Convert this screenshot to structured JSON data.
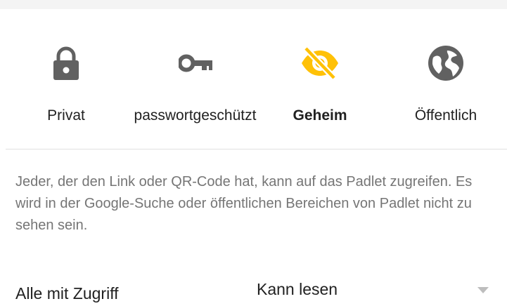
{
  "privacy": {
    "options": [
      {
        "id": "private",
        "label": "Privat",
        "icon": "lock-icon",
        "selected": false
      },
      {
        "id": "password",
        "label": "passwortgeschützt",
        "icon": "key-icon",
        "selected": false
      },
      {
        "id": "secret",
        "label": "Geheim",
        "icon": "eye-off-icon",
        "selected": true
      },
      {
        "id": "public",
        "label": "Öffentlich",
        "icon": "globe-icon",
        "selected": false
      }
    ]
  },
  "description": "Jeder, der den Link oder QR-Code hat, kann auf das Padlet zugreifen. Es wird in der Google-Suche oder öffentlichen Bereichen von Padlet nicht zu sehen sein.",
  "access": {
    "label": "Alle mit Zugriff",
    "selected_value": "Kann lesen"
  },
  "colors": {
    "icon_default": "#616161",
    "icon_selected": "#FFC107",
    "text": "#212121",
    "description_text": "#757575",
    "divider": "#E0E0E0",
    "caret": "#BDBDBD"
  }
}
